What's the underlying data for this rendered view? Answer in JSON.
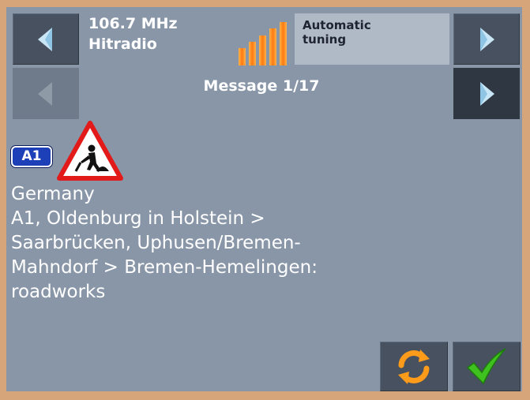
{
  "radio": {
    "frequency": "106.7 MHz",
    "station": "Hitradio",
    "tuning_mode_line1": "Automatic",
    "tuning_mode_line2": "tuning",
    "signal_bars": 5
  },
  "message": {
    "counter": "Message 1/17",
    "road_label": "A1",
    "event_icon": "roadworks-warning-icon",
    "lines": [
      "Germany",
      "A1, Oldenburg in Holstein >",
      "Saarbrücken, Uphusen/Bremen-",
      "Mahndorf > Bremen-Hemelingen:",
      "roadworks"
    ]
  },
  "controls": {
    "prev_station_icon": "arrow-left-icon",
    "next_station_icon": "arrow-right-icon",
    "prev_message_icon": "arrow-left-icon",
    "next_message_icon": "arrow-right-icon",
    "refresh_icon": "refresh-icon",
    "confirm_icon": "checkmark-icon"
  },
  "colors": {
    "background": "#8896a8",
    "frame": "#d6a57a",
    "signal": "#ff8a1e",
    "road_badge": "#1d3fb8",
    "warning_red": "#e21a1a",
    "check_green": "#3fc11f",
    "refresh_orange": "#ff9b1a"
  }
}
